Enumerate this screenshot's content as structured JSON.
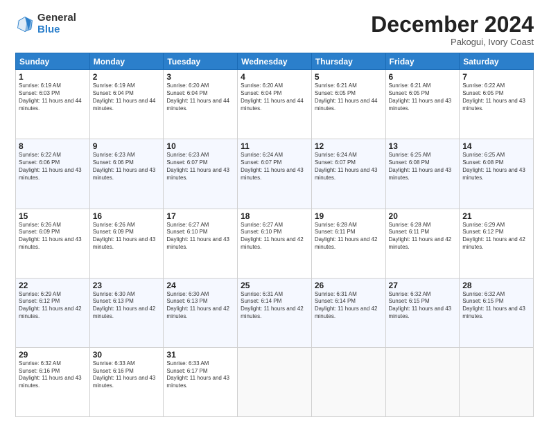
{
  "logo": {
    "general": "General",
    "blue": "Blue"
  },
  "header": {
    "month": "December 2024",
    "location": "Pakogui, Ivory Coast"
  },
  "weekdays": [
    "Sunday",
    "Monday",
    "Tuesday",
    "Wednesday",
    "Thursday",
    "Friday",
    "Saturday"
  ],
  "weeks": [
    [
      {
        "day": "1",
        "sunrise": "6:19 AM",
        "sunset": "6:03 PM",
        "daylight": "11 hours and 44 minutes."
      },
      {
        "day": "2",
        "sunrise": "6:19 AM",
        "sunset": "6:04 PM",
        "daylight": "11 hours and 44 minutes."
      },
      {
        "day": "3",
        "sunrise": "6:20 AM",
        "sunset": "6:04 PM",
        "daylight": "11 hours and 44 minutes."
      },
      {
        "day": "4",
        "sunrise": "6:20 AM",
        "sunset": "6:04 PM",
        "daylight": "11 hours and 44 minutes."
      },
      {
        "day": "5",
        "sunrise": "6:21 AM",
        "sunset": "6:05 PM",
        "daylight": "11 hours and 44 minutes."
      },
      {
        "day": "6",
        "sunrise": "6:21 AM",
        "sunset": "6:05 PM",
        "daylight": "11 hours and 43 minutes."
      },
      {
        "day": "7",
        "sunrise": "6:22 AM",
        "sunset": "6:05 PM",
        "daylight": "11 hours and 43 minutes."
      }
    ],
    [
      {
        "day": "8",
        "sunrise": "6:22 AM",
        "sunset": "6:06 PM",
        "daylight": "11 hours and 43 minutes."
      },
      {
        "day": "9",
        "sunrise": "6:23 AM",
        "sunset": "6:06 PM",
        "daylight": "11 hours and 43 minutes."
      },
      {
        "day": "10",
        "sunrise": "6:23 AM",
        "sunset": "6:07 PM",
        "daylight": "11 hours and 43 minutes."
      },
      {
        "day": "11",
        "sunrise": "6:24 AM",
        "sunset": "6:07 PM",
        "daylight": "11 hours and 43 minutes."
      },
      {
        "day": "12",
        "sunrise": "6:24 AM",
        "sunset": "6:07 PM",
        "daylight": "11 hours and 43 minutes."
      },
      {
        "day": "13",
        "sunrise": "6:25 AM",
        "sunset": "6:08 PM",
        "daylight": "11 hours and 43 minutes."
      },
      {
        "day": "14",
        "sunrise": "6:25 AM",
        "sunset": "6:08 PM",
        "daylight": "11 hours and 43 minutes."
      }
    ],
    [
      {
        "day": "15",
        "sunrise": "6:26 AM",
        "sunset": "6:09 PM",
        "daylight": "11 hours and 43 minutes."
      },
      {
        "day": "16",
        "sunrise": "6:26 AM",
        "sunset": "6:09 PM",
        "daylight": "11 hours and 43 minutes."
      },
      {
        "day": "17",
        "sunrise": "6:27 AM",
        "sunset": "6:10 PM",
        "daylight": "11 hours and 43 minutes."
      },
      {
        "day": "18",
        "sunrise": "6:27 AM",
        "sunset": "6:10 PM",
        "daylight": "11 hours and 42 minutes."
      },
      {
        "day": "19",
        "sunrise": "6:28 AM",
        "sunset": "6:11 PM",
        "daylight": "11 hours and 42 minutes."
      },
      {
        "day": "20",
        "sunrise": "6:28 AM",
        "sunset": "6:11 PM",
        "daylight": "11 hours and 42 minutes."
      },
      {
        "day": "21",
        "sunrise": "6:29 AM",
        "sunset": "6:12 PM",
        "daylight": "11 hours and 42 minutes."
      }
    ],
    [
      {
        "day": "22",
        "sunrise": "6:29 AM",
        "sunset": "6:12 PM",
        "daylight": "11 hours and 42 minutes."
      },
      {
        "day": "23",
        "sunrise": "6:30 AM",
        "sunset": "6:13 PM",
        "daylight": "11 hours and 42 minutes."
      },
      {
        "day": "24",
        "sunrise": "6:30 AM",
        "sunset": "6:13 PM",
        "daylight": "11 hours and 42 minutes."
      },
      {
        "day": "25",
        "sunrise": "6:31 AM",
        "sunset": "6:14 PM",
        "daylight": "11 hours and 42 minutes."
      },
      {
        "day": "26",
        "sunrise": "6:31 AM",
        "sunset": "6:14 PM",
        "daylight": "11 hours and 42 minutes."
      },
      {
        "day": "27",
        "sunrise": "6:32 AM",
        "sunset": "6:15 PM",
        "daylight": "11 hours and 43 minutes."
      },
      {
        "day": "28",
        "sunrise": "6:32 AM",
        "sunset": "6:15 PM",
        "daylight": "11 hours and 43 minutes."
      }
    ],
    [
      {
        "day": "29",
        "sunrise": "6:32 AM",
        "sunset": "6:16 PM",
        "daylight": "11 hours and 43 minutes."
      },
      {
        "day": "30",
        "sunrise": "6:33 AM",
        "sunset": "6:16 PM",
        "daylight": "11 hours and 43 minutes."
      },
      {
        "day": "31",
        "sunrise": "6:33 AM",
        "sunset": "6:17 PM",
        "daylight": "11 hours and 43 minutes."
      },
      null,
      null,
      null,
      null
    ]
  ]
}
